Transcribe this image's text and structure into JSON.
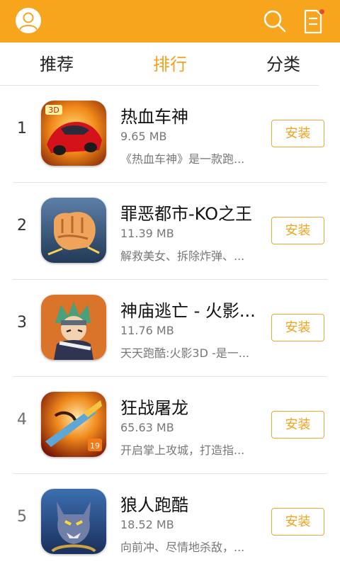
{
  "header": {
    "avatar_icon": "user-avatar-icon",
    "search_icon": "search-icon",
    "download_icon": "download-manager-icon",
    "accent": "#f7a51d"
  },
  "tabs": [
    {
      "label": "推荐",
      "active": false
    },
    {
      "label": "排行",
      "active": true
    },
    {
      "label": "分类",
      "active": false
    }
  ],
  "apps": [
    {
      "rank": "1",
      "title": "热血车神",
      "size": "9.65 MB",
      "desc": "《热血车神》是一款跑...",
      "install": "安装"
    },
    {
      "rank": "2",
      "title": "罪恶都市-KO之王",
      "size": "11.39 MB",
      "desc": "解救美女、拆除炸弹、...",
      "install": "安装"
    },
    {
      "rank": "3",
      "title": "神庙逃亡 - 火影...",
      "size": "11.76 MB",
      "desc": "天天跑酷:火影3D -是一...",
      "install": "安装"
    },
    {
      "rank": "4",
      "title": "狂战屠龙",
      "size": "65.63 MB",
      "desc": "开启掌上攻城，打造指...",
      "install": "安装"
    },
    {
      "rank": "5",
      "title": "狼人跑酷",
      "size": "18.52 MB",
      "desc": "向前冲、尽情地杀敌，...",
      "install": "安装"
    }
  ]
}
